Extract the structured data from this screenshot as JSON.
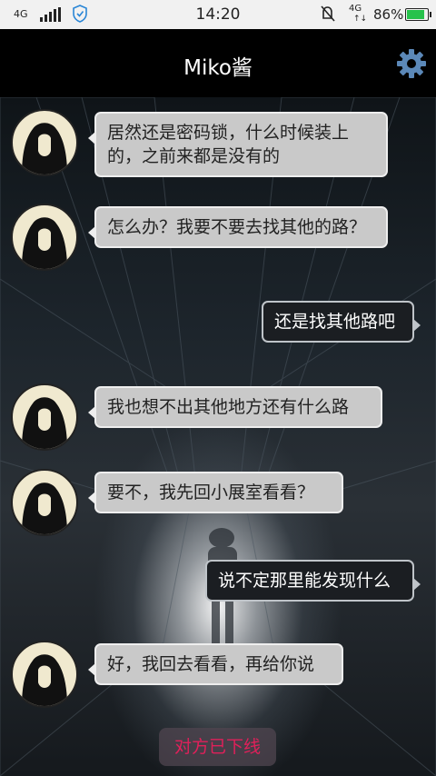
{
  "status_bar": {
    "signal_label": "4G",
    "time": "14:20",
    "network_label": "4G",
    "battery_percent": "86%",
    "battery_level": 0.86,
    "icons": [
      "signal-icon",
      "vpn-shield-icon",
      "mute-icon",
      "battery-icon"
    ]
  },
  "header": {
    "title": "Miko酱",
    "settings_icon": "gear-icon"
  },
  "messages": [
    {
      "side": "left",
      "text": "居然还是密码锁，什么时候装上的，之前来都是没有的"
    },
    {
      "side": "left",
      "text": "怎么办？我要不要去找其他的路？"
    },
    {
      "side": "right",
      "text": "还是找其他路吧"
    },
    {
      "side": "left",
      "text": "我也想不出其他地方还有什么路"
    },
    {
      "side": "left",
      "text": "要不，我先回小展室看看？"
    },
    {
      "side": "right",
      "text": "说不定那里能发现什么"
    },
    {
      "side": "left",
      "text": "好，我回去看看，再给你说"
    }
  ],
  "offline_notice": "对方已下线",
  "colors": {
    "accent_gear": "#5b88b8",
    "offline_text": "#e0205a",
    "left_bubble": "#c9c9c9",
    "right_bubble": "#1b1e22"
  }
}
